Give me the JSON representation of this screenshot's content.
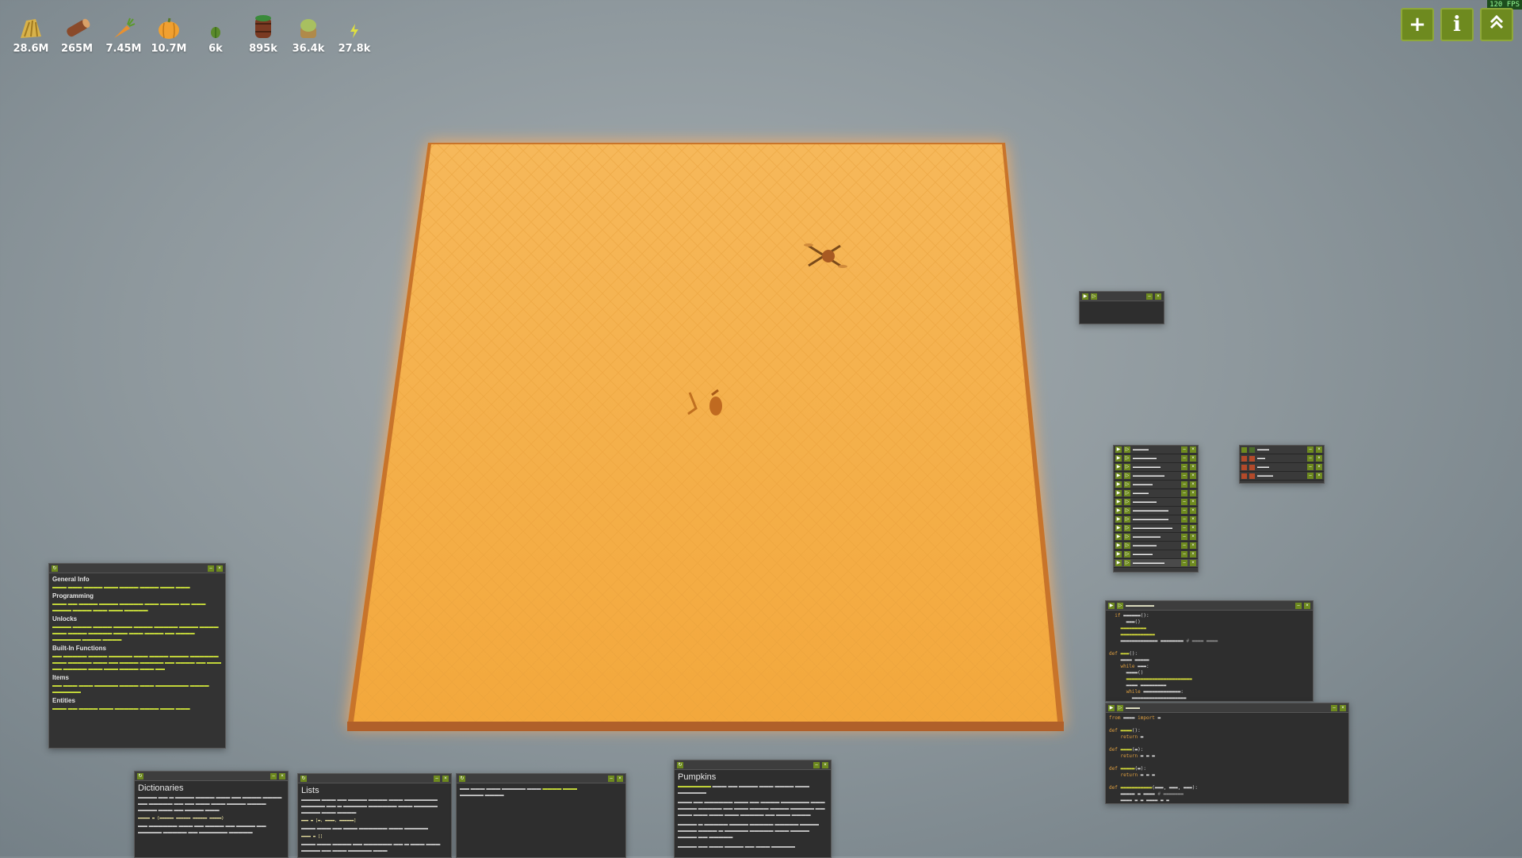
{
  "fps": "120 FPS",
  "resources": [
    {
      "name": "hay",
      "icon": "hay-icon",
      "value": "28.6M",
      "color": "#d8b24a"
    },
    {
      "name": "wood",
      "icon": "wood-icon",
      "value": "265M",
      "color": "#8a4a2a"
    },
    {
      "name": "carrot",
      "icon": "carrot-icon",
      "value": "7.45M",
      "color": "#e89030"
    },
    {
      "name": "pumpkin",
      "icon": "pumpkin-icon",
      "value": "10.7M",
      "color": "#f0a030"
    },
    {
      "name": "cactus",
      "icon": "cactus-icon",
      "value": "6k",
      "color": "#5a8a2a"
    },
    {
      "name": "weird-substance",
      "icon": "barrel-icon",
      "value": "895k",
      "color": "#4a6a3a"
    },
    {
      "name": "bone",
      "icon": "bone-icon",
      "value": "36.4k",
      "color": "#a8c060"
    },
    {
      "name": "power",
      "icon": "lightning-icon",
      "value": "27.8k",
      "color": "#e0e040"
    }
  ],
  "top_buttons": {
    "add": "+",
    "info": "i",
    "up": "^"
  },
  "general_info": {
    "title": "General Info",
    "sections": [
      {
        "heading": "Programming"
      },
      {
        "heading": "Unlocks"
      },
      {
        "heading": "Built-In Functions"
      },
      {
        "heading": "Items"
      },
      {
        "heading": "Entities"
      }
    ]
  },
  "docs": {
    "dictionaries": {
      "title": "Dictionaries"
    },
    "lists": {
      "title": "Lists"
    },
    "pumpkins": {
      "title": "Pumpkins"
    }
  },
  "colors": {
    "field": "#f5b04a",
    "accent": "#6e8a1f",
    "link": "#cfe43b"
  }
}
